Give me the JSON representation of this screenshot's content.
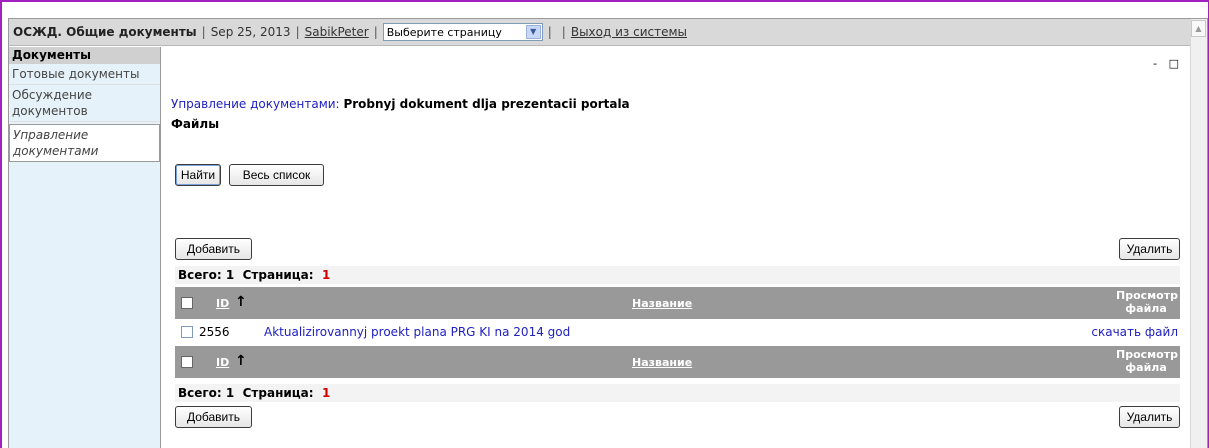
{
  "topbar": {
    "app_title": "ОСЖД. Общие документы",
    "date": "Sep 25, 2013",
    "user": "SabikPeter ",
    "page_select": "Выберите страницу",
    "logout": "Выход из системы"
  },
  "sidebar": {
    "heading": "Документы",
    "items": [
      {
        "label": "Готовые документы"
      },
      {
        "label": "Обсуждение документов"
      },
      {
        "label": "Управление документами"
      }
    ]
  },
  "main": {
    "window_controls": "- □",
    "breadcrumb_link": "Управление документами:",
    "doc_title": "Probnyj dokument dlja prezentacii portala",
    "section_title": "Файлы",
    "find_button": "Найти",
    "all_list_button": "Весь список",
    "add_button": "Добавить",
    "delete_button": "Удалить",
    "total_label": "Всего:",
    "total_value": "1",
    "page_label": "Страница:",
    "page_value": "1",
    "grid": {
      "col_id": "ID",
      "col_name": "Название",
      "col_view": "Просмотр файла",
      "sort_arrow": "↑",
      "rows": [
        {
          "id": "2556",
          "name": "Aktualizirovannyj proekt plana PRG KI na 2014 god",
          "action": "скачать файл"
        }
      ]
    }
  }
}
